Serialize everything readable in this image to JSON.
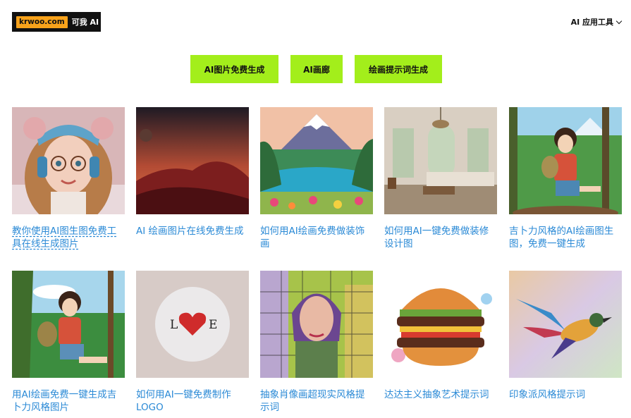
{
  "header": {
    "logo_badge": "krwoo.com",
    "logo_text": "可我 AI",
    "menu_label": "AI 应用工具"
  },
  "buttons": [
    {
      "label": "AI图片免费生成"
    },
    {
      "label": "AI画廊"
    },
    {
      "label": "绘画提示词生成"
    }
  ],
  "gallery": [
    {
      "title": "教你使用AI图生图免费工具在线生成图片",
      "image": "girl-with-headphones"
    },
    {
      "title": "AI 绘画图片在线免费生成",
      "image": "red-desert-dunes"
    },
    {
      "title": "如何用AI绘画免费做装饰画",
      "image": "mountain-lake-landscape"
    },
    {
      "title": "如何用AI一键免费做装修设计图",
      "image": "living-room-interior"
    },
    {
      "title": "吉卜力风格的AI绘画图生图，免费一键生成",
      "image": "ghibli-girl-mountains"
    },
    {
      "title": "用AI绘画免费一键生成吉卜力风格图片",
      "image": "ghibli-girl-backpack"
    },
    {
      "title": "如何用AI一键免费制作LOGO",
      "image": "love-heart-logo"
    },
    {
      "title": "抽象肖像画超现实风格提示词",
      "image": "abstract-portrait"
    },
    {
      "title": "达达主义抽象艺术提示词",
      "image": "dada-burger"
    },
    {
      "title": "印象派风格提示词",
      "image": "impressionist-bird"
    }
  ]
}
